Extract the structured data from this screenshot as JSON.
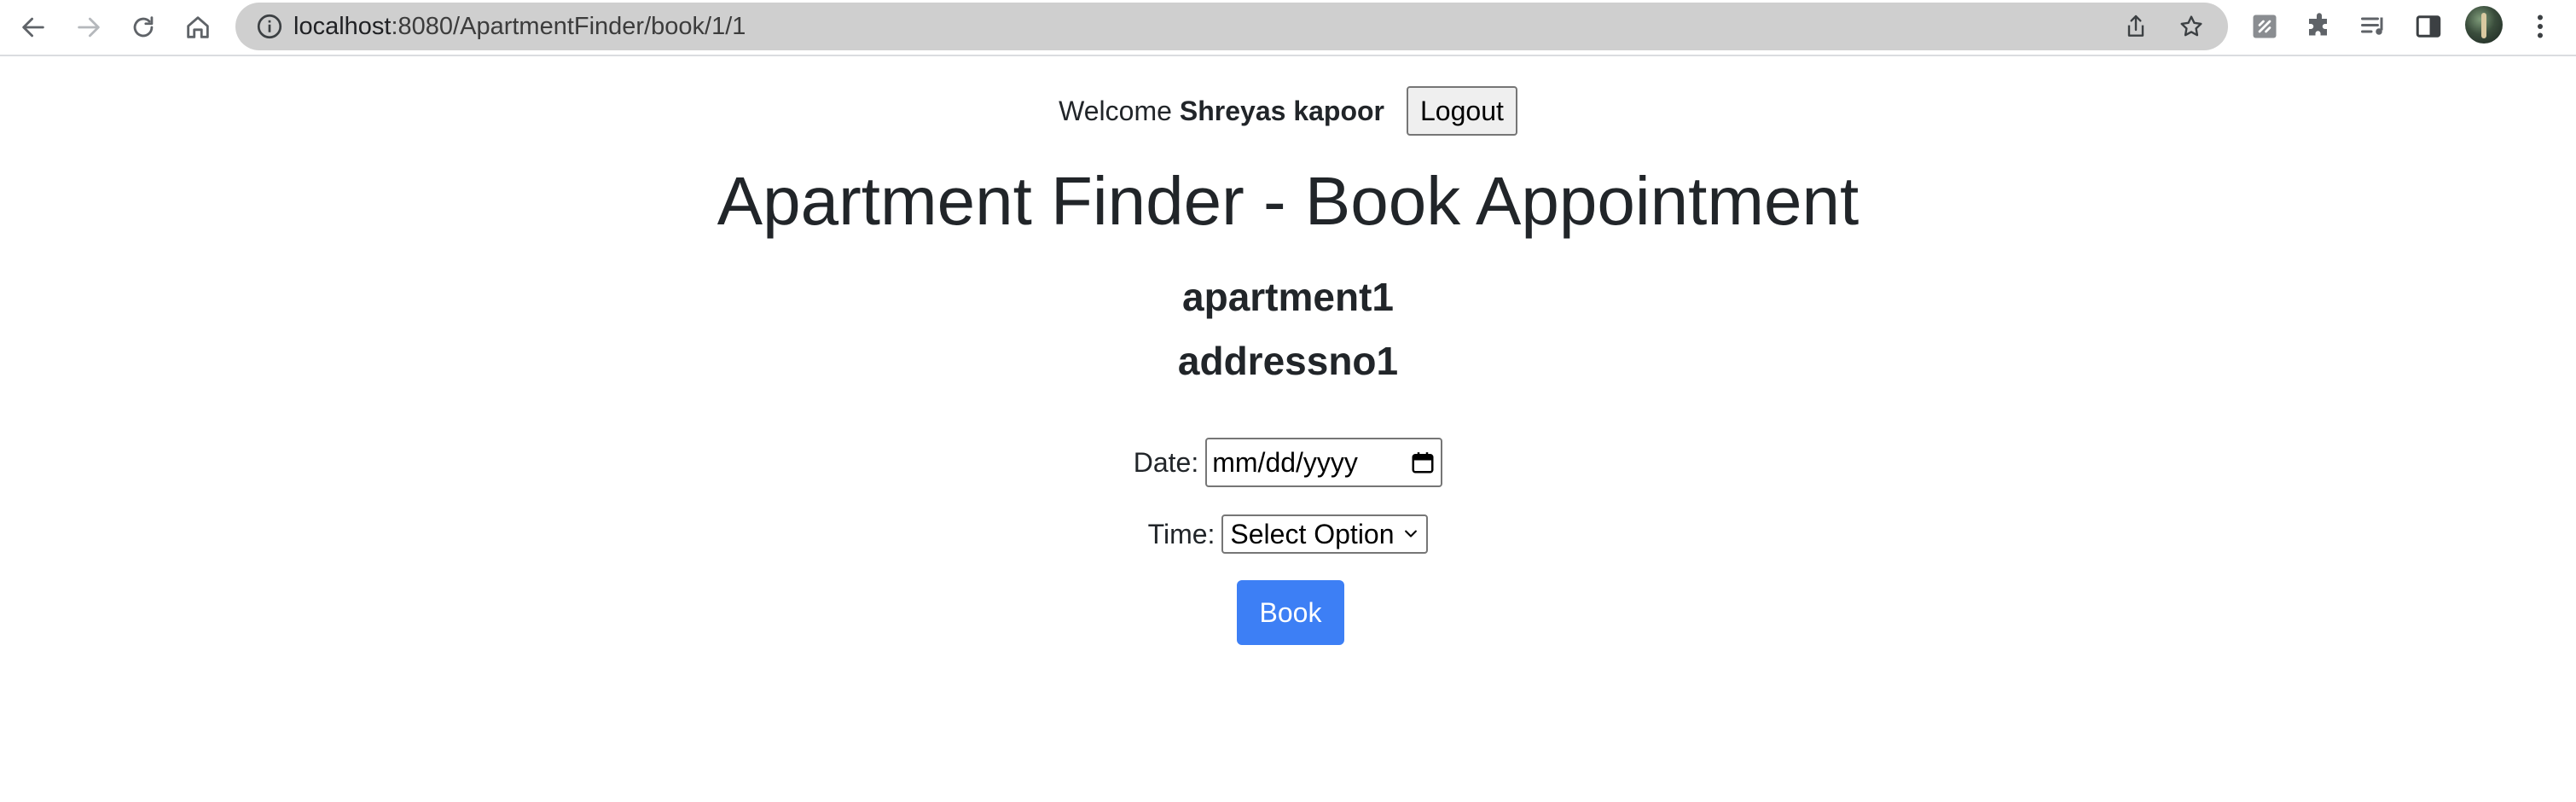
{
  "browser": {
    "url_host": "localhost",
    "url_rest": ":8080/ApartmentFinder/book/1/1",
    "icons": {
      "back": "arrow-left-icon",
      "forward": "arrow-right-icon",
      "reload": "reload-icon",
      "home": "home-icon",
      "site_info": "info-icon",
      "share": "share-icon",
      "bookmark": "star-icon",
      "extension": "extension-icon",
      "puzzle": "puzzle-icon",
      "media": "media-queue-icon",
      "side_panel": "side-panel-icon",
      "menu": "kebab-menu-icon"
    }
  },
  "header": {
    "welcome_label": "Welcome",
    "user_name": "Shreyas kapoor",
    "logout_label": "Logout"
  },
  "main": {
    "title": "Apartment Finder - Book Appointment",
    "apartment_name": "apartment1",
    "apartment_address": "addressno1"
  },
  "form": {
    "date_label": "Date:",
    "date_placeholder": "mm/dd/yyyy",
    "time_label": "Time:",
    "time_selected": "Select Option",
    "book_label": "Book"
  },
  "colors": {
    "primary_button": "#3d7ff5",
    "text": "#212529",
    "omnibox": "#cfcfcf"
  }
}
